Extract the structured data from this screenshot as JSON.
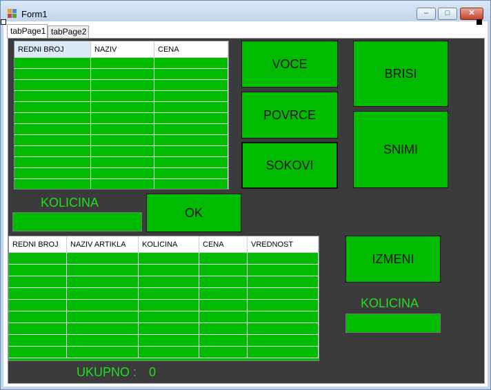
{
  "window": {
    "title": "Form1",
    "minimize": "–",
    "maximize": "□",
    "close": "✕"
  },
  "tabs": [
    {
      "label": "tabPage1",
      "active": false
    },
    {
      "label": "tabPage2",
      "active": true
    }
  ],
  "colors": {
    "panel": "#3b3b3b",
    "green": "#00bb00",
    "label_green": "#1fe01f"
  },
  "top_grid": {
    "columns": [
      "REDNI BROJ",
      "NAZIV",
      "CENA"
    ],
    "row_count": 12
  },
  "bottom_grid": {
    "columns": [
      "REDNI BROJ",
      "NAZIV ARTIKLA",
      "KOLICINA",
      "CENA",
      "VREDNOST"
    ],
    "row_count": 9
  },
  "buttons": {
    "voce": "VOCE",
    "povrce": "POVRCE",
    "sokovi": "SOKOVI",
    "brisi": "BRISI",
    "snimi": "SNIMI",
    "ok": "OK",
    "izmeni": "IZMENI"
  },
  "labels": {
    "kolicina_left": "KOLICINA",
    "kolicina_right": "KOLICINA",
    "ukupno": "UKUPNO :",
    "ukupno_value": "0"
  },
  "inputs": {
    "kolicina_left_value": "",
    "kolicina_right_value": ""
  }
}
